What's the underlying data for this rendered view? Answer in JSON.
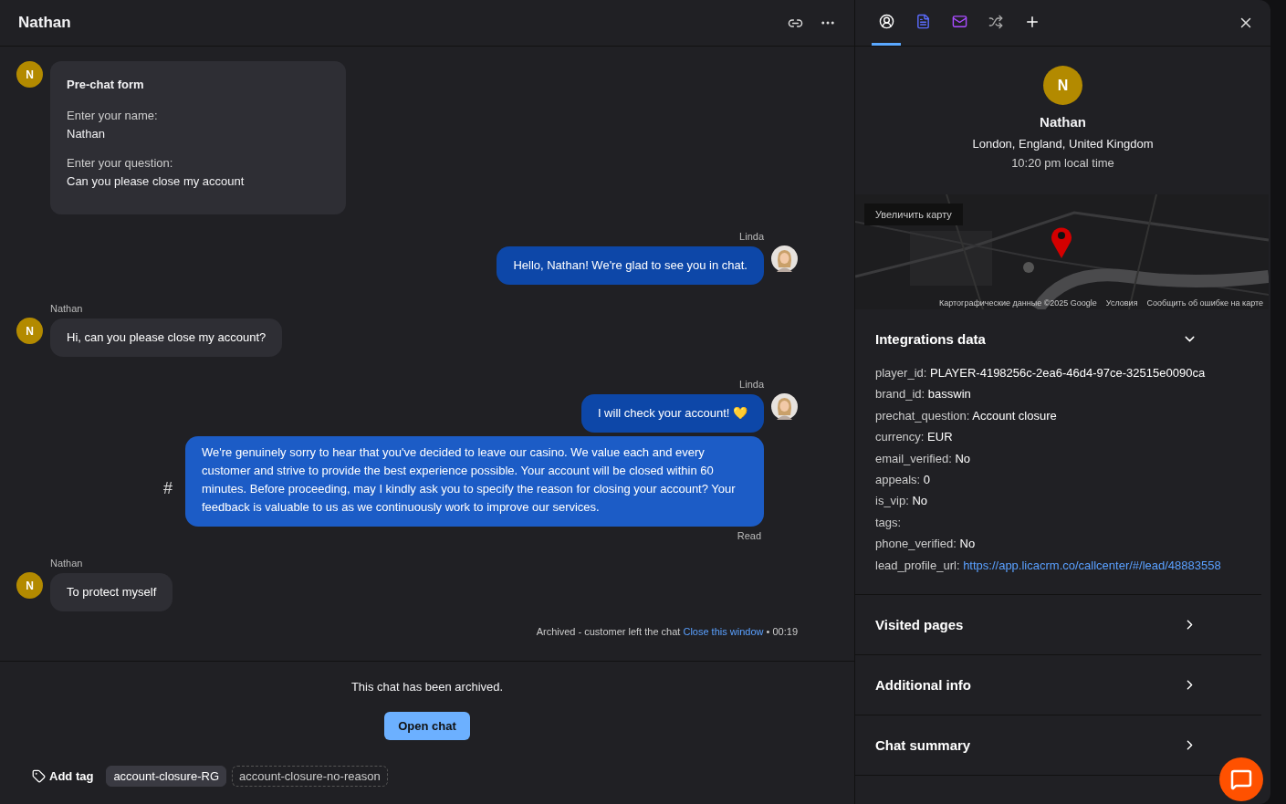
{
  "chat": {
    "title": "Nathan",
    "messages": [
      {
        "kind": "form",
        "avatar": "N",
        "title": "Pre-chat form",
        "fields": [
          {
            "label": "Enter your name:",
            "value": "Nathan"
          },
          {
            "label": "Enter your question:",
            "value": "Can you please close my account"
          }
        ]
      },
      {
        "kind": "agent",
        "author": "Linda",
        "text": "Hello, Nathan! We're glad to see you in chat."
      },
      {
        "kind": "visitor",
        "author": "Nathan",
        "avatar": "N",
        "text": "Hi, can you please close my account?"
      },
      {
        "kind": "agent",
        "author": "Linda",
        "text": "I will check your account! 💛"
      },
      {
        "kind": "agent_long",
        "marker": "#",
        "text": "We're genuinely sorry to hear that you've decided to leave our casino. We value each and every customer and strive to provide the best experience possible. Your account will be closed within 60 minutes. Before proceeding, may I kindly ask you to specify the reason for closing your account? Your feedback is valuable to us as we continuously work to improve our services.",
        "status": "Read"
      },
      {
        "kind": "visitor",
        "author": "Nathan",
        "avatar": "N",
        "text": "To protect myself"
      },
      {
        "kind": "system",
        "text": "Archived - customer left the chat",
        "link": "Close this window",
        "separator": "•",
        "time": "00:19"
      }
    ],
    "archived_notice": "This chat has been archived.",
    "open_button": "Open chat",
    "add_tag": "Add tag",
    "tags": [
      {
        "label": "account-closure-RG",
        "selected": true
      },
      {
        "label": "account-closure-no-reason",
        "selected": false
      }
    ]
  },
  "details": {
    "tabs": [
      {
        "selected": true
      },
      {
        "selected": false
      },
      {
        "selected": false
      },
      {
        "selected": false
      },
      {
        "selected": false
      }
    ],
    "avatar": "N",
    "name": "Nathan",
    "location": "London, England, United Kingdom",
    "local_time": "10:20 pm local time",
    "map": {
      "kind": "picture",
      "enlarge": "Увеличить карту",
      "attribution": [
        "Картографические данные ©2025 Google",
        "Условия",
        "Сообщить об ошибке на карте"
      ]
    },
    "integrations": {
      "title": "Integrations data",
      "expanded": true,
      "rows": [
        {
          "key": "player_id:",
          "value": "PLAYER-4198256c-2ea6-46d4-97ce-32515e0090ca"
        },
        {
          "key": "brand_id:",
          "value": "basswin"
        },
        {
          "key": "prechat_question:",
          "value": "Account closure"
        },
        {
          "key": "currency:",
          "value": "EUR"
        },
        {
          "key": "email_verified:",
          "value": "No"
        },
        {
          "key": "appeals:",
          "value": "0"
        },
        {
          "key": "is_vip:",
          "value": "No"
        },
        {
          "key": "tags:"
        },
        {
          "key": "phone_verified:",
          "value": "No"
        },
        {
          "key": "lead_profile_url:",
          "value": "https://app.licacrm.co/callcenter/#/lead/48883558",
          "kind": "link"
        }
      ]
    },
    "sections": [
      {
        "title": "Visited pages",
        "expanded": false
      },
      {
        "title": "Additional info",
        "expanded": false
      },
      {
        "title": "Chat summary",
        "expanded": false
      }
    ]
  }
}
